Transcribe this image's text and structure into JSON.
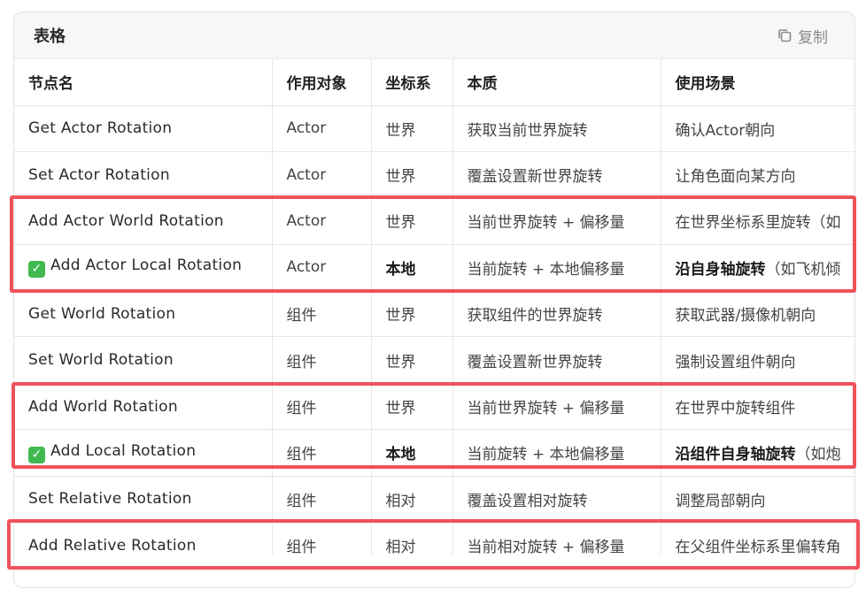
{
  "card": {
    "title": "表格",
    "copy_label": "复制",
    "copy_icon": "copy-icon"
  },
  "table": {
    "headers": [
      "节点名",
      "作用对象",
      "坐标系",
      "本质",
      "使用场景"
    ],
    "rows": [
      {
        "node": "Get Actor Rotation",
        "target": "Actor",
        "coord": "世界",
        "nature": "获取当前世界旋转",
        "usage_bold": "",
        "usage": "确认Actor朝向"
      },
      {
        "node": "Set Actor Rotation",
        "target": "Actor",
        "coord": "世界",
        "nature": "覆盖设置新世界旋转",
        "usage_bold": "",
        "usage": "让角色面向某方向"
      },
      {
        "node": "Add Actor World Rotation",
        "target": "Actor",
        "coord": "世界",
        "nature": "当前世界旋转 + 偏移量",
        "usage_bold": "",
        "usage": "在世界坐标系里旋转（如"
      },
      {
        "node": "Add Actor Local Rotation",
        "target": "Actor",
        "coord": "本地",
        "nature": "当前旋转 + 本地偏移量",
        "usage_bold": "沿自身轴旋转",
        "usage": "（如飞机倾"
      },
      {
        "node": "Get World Rotation",
        "target": "组件",
        "coord": "世界",
        "nature": "获取组件的世界旋转",
        "usage_bold": "",
        "usage": "获取武器/摄像机朝向"
      },
      {
        "node": "Set World Rotation",
        "target": "组件",
        "coord": "世界",
        "nature": "覆盖设置新世界旋转",
        "usage_bold": "",
        "usage": "强制设置组件朝向"
      },
      {
        "node": "Add World Rotation",
        "target": "组件",
        "coord": "世界",
        "nature": "当前世界旋转 + 偏移量",
        "usage_bold": "",
        "usage": "在世界中旋转组件"
      },
      {
        "node": "Add Local Rotation",
        "target": "组件",
        "coord": "本地",
        "nature": "当前旋转 + 本地偏移量",
        "usage_bold": "沿组件自身轴旋转",
        "usage": "（如炮"
      },
      {
        "node": "Set Relative Rotation",
        "target": "组件",
        "coord": "相对",
        "nature": "覆盖设置相对旋转",
        "usage_bold": "",
        "usage": "调整局部朝向"
      },
      {
        "node": "Add Relative Rotation",
        "target": "组件",
        "coord": "相对",
        "nature": "当前相对旋转 + 偏移量",
        "usage_bold": "",
        "usage": "在父组件坐标系里偏转角"
      }
    ]
  },
  "colors": {
    "highlight": "#f0525a",
    "check": "#3fb950"
  }
}
